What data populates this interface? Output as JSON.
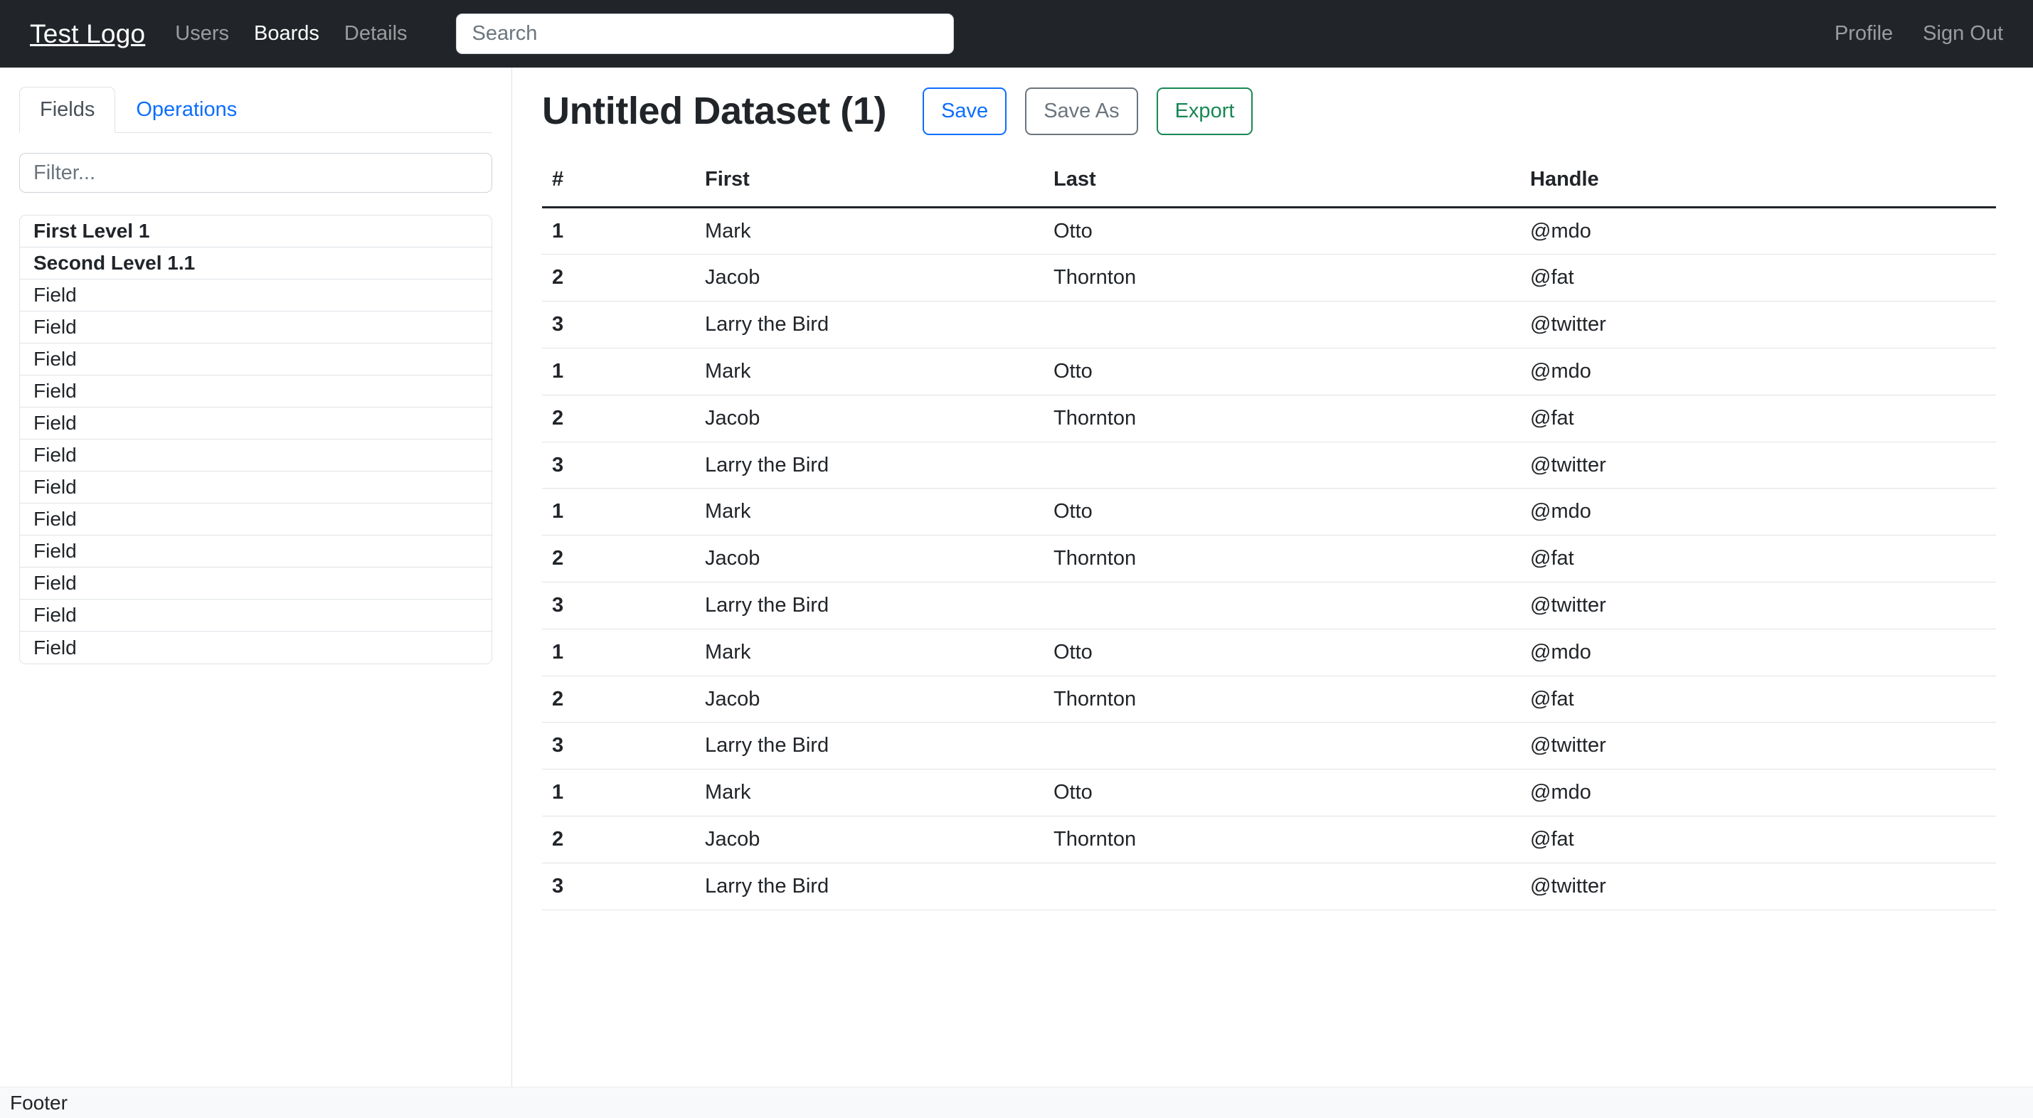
{
  "navbar": {
    "brand": "Test Logo",
    "links": [
      {
        "label": "Users",
        "active": false
      },
      {
        "label": "Boards",
        "active": true
      },
      {
        "label": "Details",
        "active": false
      }
    ],
    "search": {
      "value": "",
      "placeholder": "Search"
    },
    "right_links": [
      {
        "label": "Profile"
      },
      {
        "label": "Sign Out"
      }
    ]
  },
  "sidebar": {
    "tabs": [
      {
        "label": "Fields",
        "active": true
      },
      {
        "label": "Operations",
        "active": false
      }
    ],
    "filter": {
      "value": "",
      "placeholder": "Filter..."
    },
    "items": [
      {
        "label": "First Level 1",
        "header": true
      },
      {
        "label": "Second Level 1.1",
        "header": true
      },
      {
        "label": "Field",
        "header": false
      },
      {
        "label": "Field",
        "header": false
      },
      {
        "label": "Field",
        "header": false
      },
      {
        "label": "Field",
        "header": false
      },
      {
        "label": "Field",
        "header": false
      },
      {
        "label": "Field",
        "header": false
      },
      {
        "label": "Field",
        "header": false
      },
      {
        "label": "Field",
        "header": false
      },
      {
        "label": "Field",
        "header": false
      },
      {
        "label": "Field",
        "header": false
      },
      {
        "label": "Field",
        "header": false
      },
      {
        "label": "Field",
        "header": false
      }
    ]
  },
  "main": {
    "title": "Untitled Dataset (1)",
    "actions": [
      {
        "label": "Save",
        "style": "save"
      },
      {
        "label": "Save As",
        "style": "saveas"
      },
      {
        "label": "Export",
        "style": "export"
      }
    ],
    "table": {
      "columns": [
        "#",
        "First",
        "Last",
        "Handle"
      ],
      "rows": [
        {
          "num": "1",
          "first": "Mark",
          "last": "Otto",
          "handle": "@mdo"
        },
        {
          "num": "2",
          "first": "Jacob",
          "last": "Thornton",
          "handle": "@fat"
        },
        {
          "num": "3",
          "first": "Larry the Bird",
          "last": "",
          "handle": "@twitter"
        },
        {
          "num": "1",
          "first": "Mark",
          "last": "Otto",
          "handle": "@mdo"
        },
        {
          "num": "2",
          "first": "Jacob",
          "last": "Thornton",
          "handle": "@fat"
        },
        {
          "num": "3",
          "first": "Larry the Bird",
          "last": "",
          "handle": "@twitter"
        },
        {
          "num": "1",
          "first": "Mark",
          "last": "Otto",
          "handle": "@mdo"
        },
        {
          "num": "2",
          "first": "Jacob",
          "last": "Thornton",
          "handle": "@fat"
        },
        {
          "num": "3",
          "first": "Larry the Bird",
          "last": "",
          "handle": "@twitter"
        },
        {
          "num": "1",
          "first": "Mark",
          "last": "Otto",
          "handle": "@mdo"
        },
        {
          "num": "2",
          "first": "Jacob",
          "last": "Thornton",
          "handle": "@fat"
        },
        {
          "num": "3",
          "first": "Larry the Bird",
          "last": "",
          "handle": "@twitter"
        },
        {
          "num": "1",
          "first": "Mark",
          "last": "Otto",
          "handle": "@mdo"
        },
        {
          "num": "2",
          "first": "Jacob",
          "last": "Thornton",
          "handle": "@fat"
        },
        {
          "num": "3",
          "first": "Larry the Bird",
          "last": "",
          "handle": "@twitter"
        }
      ]
    }
  },
  "footer": {
    "label": "Footer"
  },
  "colors": {
    "navbar_bg": "#212529",
    "accent_blue": "#0d6efd",
    "accent_gray": "#6c757d",
    "accent_green": "#198754",
    "border": "#dee2e6",
    "footer_bg": "#f8f9fa"
  }
}
